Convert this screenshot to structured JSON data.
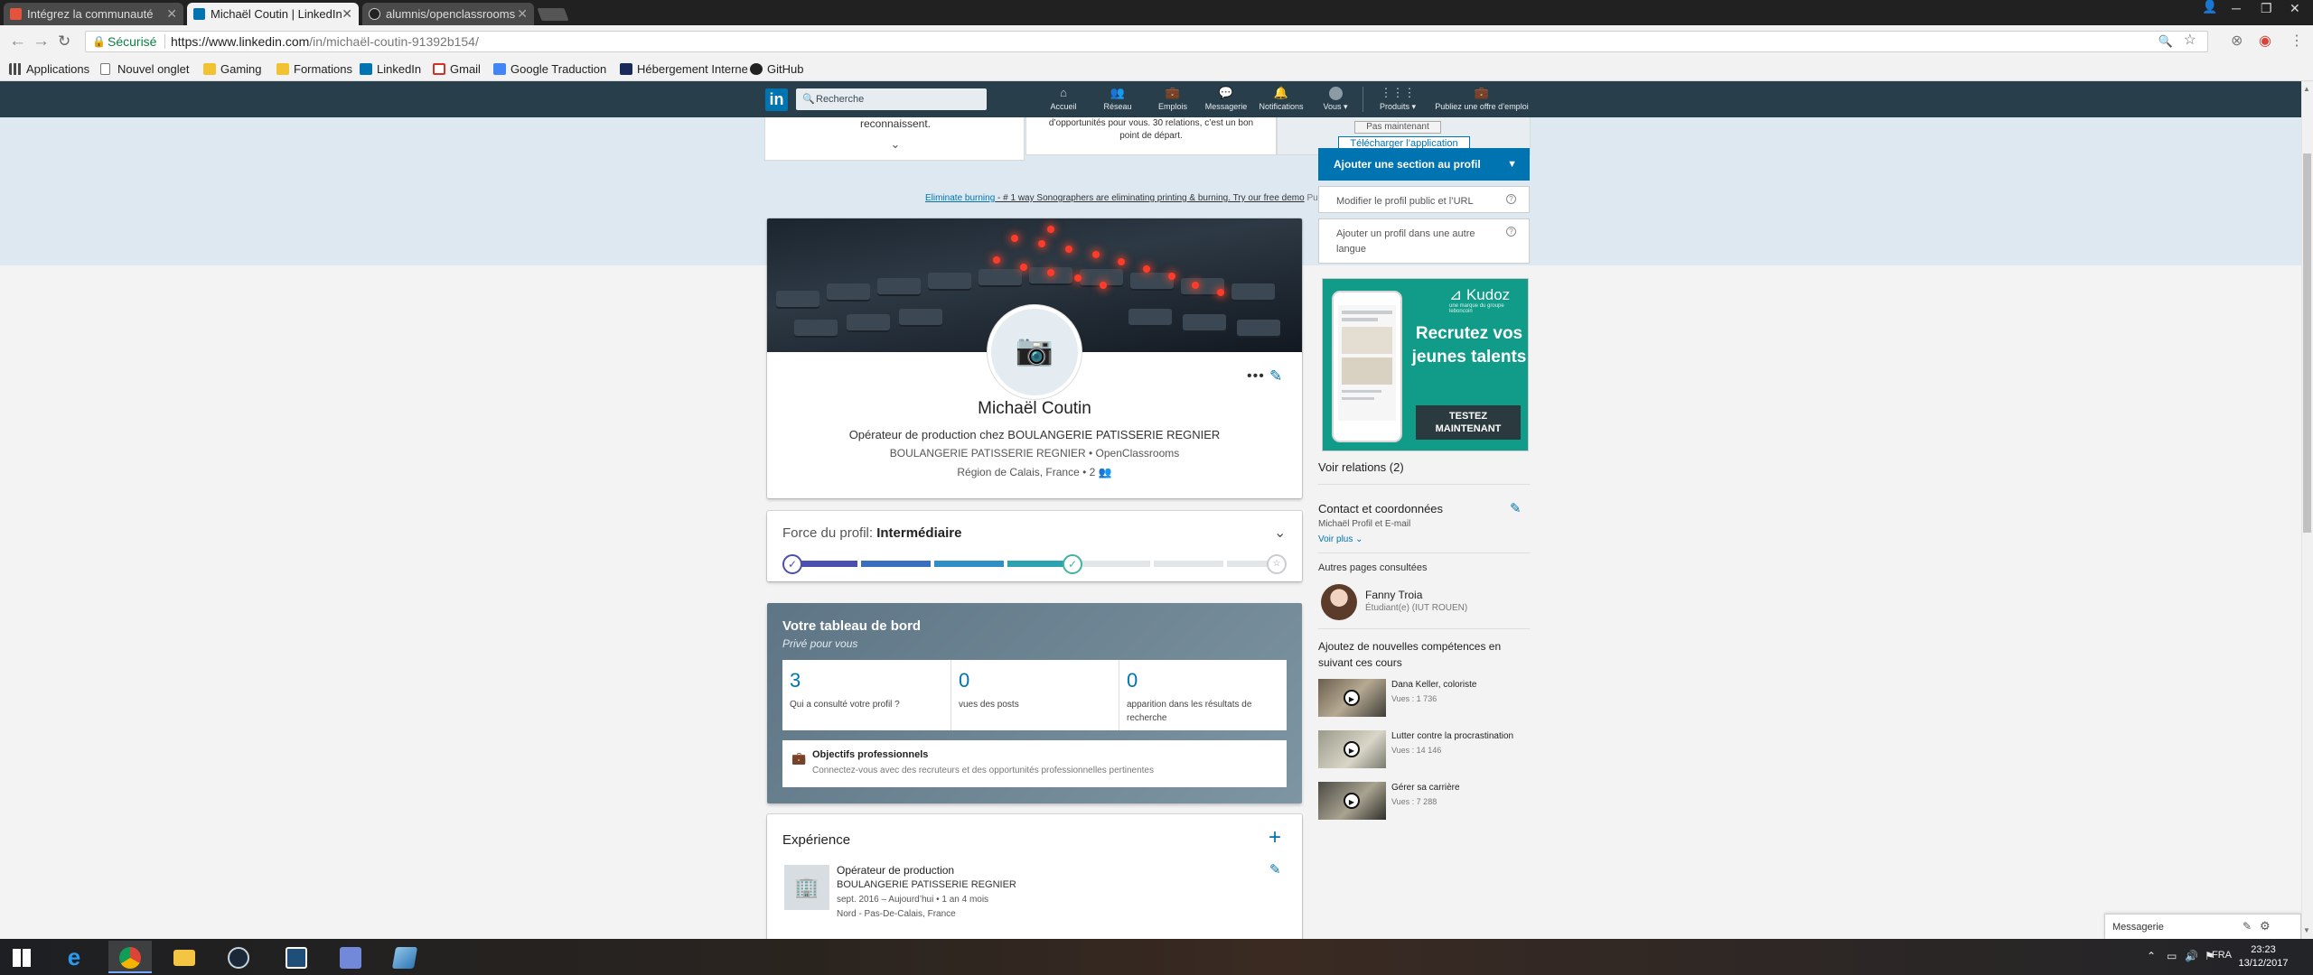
{
  "browser": {
    "tabs": [
      {
        "title": "Intégrez la communauté",
        "favicon_color": "#e5533d"
      },
      {
        "title": "Michaël Coutin | LinkedIn",
        "favicon_color": "#0073b1"
      },
      {
        "title": "alumnis/openclassrooms",
        "favicon_color": "#222222"
      }
    ],
    "security_label": "Sécurisé",
    "url_host": "https://www.linkedin.com",
    "url_path": "/in/michaël-coutin-91392b154/",
    "bookmarks": [
      {
        "label": "Applications",
        "icon": "apps-grid-icon"
      },
      {
        "label": "Nouvel onglet",
        "icon": "page-icon"
      },
      {
        "label": "Gaming",
        "icon": "folder-icon"
      },
      {
        "label": "Formations",
        "icon": "folder-icon"
      },
      {
        "label": "LinkedIn",
        "icon": "linkedin-icon"
      },
      {
        "label": "Gmail",
        "icon": "gmail-icon"
      },
      {
        "label": "Google Traduction",
        "icon": "translate-icon"
      },
      {
        "label": "Hébergement Interne",
        "icon": "hosting-icon"
      },
      {
        "label": "GitHub",
        "icon": "github-icon"
      }
    ]
  },
  "linkedin_nav": {
    "search_placeholder": "Recherche",
    "items": [
      {
        "label": "Accueil",
        "icon": "home-icon"
      },
      {
        "label": "Réseau",
        "icon": "network-icon"
      },
      {
        "label": "Emplois",
        "icon": "jobs-icon"
      },
      {
        "label": "Messagerie",
        "icon": "messaging-icon"
      },
      {
        "label": "Notifications",
        "icon": "bell-icon"
      },
      {
        "label": "Vous ▾",
        "icon": "avatar-icon"
      },
      {
        "label": "Produits ▾",
        "icon": "grid-icon"
      },
      {
        "label": "Publiez une offre d’emploi",
        "icon": "briefcase-icon"
      }
    ]
  },
  "intro_band": {
    "card1_text": "reconnaissent.",
    "card2_line1": "d’opportunités pour vous. 30 relations, c’est un bon",
    "card2_line2": "point de départ.",
    "later_button": "Pas maintenant",
    "download_button": "Télécharger l’application"
  },
  "ad_line": {
    "link": "Eliminate burning",
    "text": " - # 1 way Sonographers are eliminating printing & burning. Try our free demo",
    "pub": "Pub ···"
  },
  "profile": {
    "name": "Michaël Coutin",
    "headline": "Opérateur de production chez BOULANGERIE PATISSERIE REGNIER",
    "company_line": "BOULANGERIE PATISSERIE REGNIER • OpenClassrooms",
    "location_line": "Région de Calais, France • 2"
  },
  "strength": {
    "label": "Force du profil: ",
    "level": "Intermédiaire",
    "progress": 0.5
  },
  "dashboard": {
    "title": "Votre tableau de bord",
    "subtitle": "Privé pour vous",
    "stats": [
      {
        "value": "3",
        "label": "Qui a consulté votre profil ?"
      },
      {
        "value": "0",
        "label": "vues des posts"
      },
      {
        "value": "0",
        "label": "apparition dans les résultats de recherche"
      }
    ],
    "objectives_title": "Objectifs professionnels",
    "objectives_desc": "Connectez-vous avec des recruteurs et des opportunités professionnelles pertinentes"
  },
  "experience": {
    "title": "Expérience",
    "role": "Opérateur de production",
    "company": "BOULANGERIE PATISSERIE REGNIER",
    "dates": "sept. 2016 – Aujourd’hui  • 1 an 4 mois",
    "location": "Nord - Pas-De-Calais, France"
  },
  "rail": {
    "add_section": "Ajouter une section au profil",
    "edit_public": "Modifier le profil public et l’URL",
    "add_language": "Ajouter un profil dans une autre langue",
    "kudoz": {
      "brand": "Kudoz",
      "brand_sub": "une marque du groupe leboncoin",
      "headline": "Recrutez vos jeunes talents",
      "button": "TESTEZ MAINTENANT",
      "accent": "#119c8a"
    },
    "see_relations": "Voir relations (2)",
    "contact_title": "Contact et coordonnées",
    "contact_desc": "Michaël Profil et E-mail",
    "see_more": "Voir plus",
    "other_pages": "Autres pages consultées",
    "suggested_person": {
      "name": "Fanny Troia",
      "detail": "Étudiant(e) (IUT ROUEN)"
    },
    "skills_title": "Ajoutez de nouvelles compétences en suivant ces cours",
    "courses": [
      {
        "title": "Dana Keller, coloriste",
        "views": "Vues : 1 736"
      },
      {
        "title": "Lutter contre la procrastination",
        "views": "Vues : 14 146"
      },
      {
        "title": "Gérer sa carrière",
        "views": "Vues : 7 288"
      }
    ]
  },
  "messaging": {
    "label": "Messagerie"
  },
  "taskbar": {
    "language": "FRA",
    "time": "23:23",
    "date": "13/12/2017"
  }
}
